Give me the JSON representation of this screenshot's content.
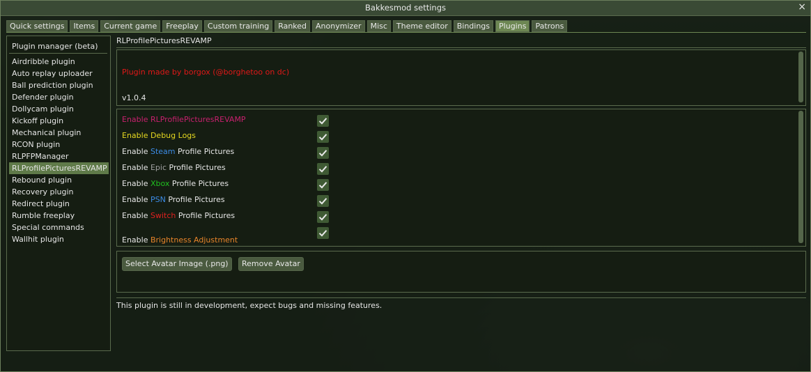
{
  "window": {
    "title": "Bakkesmod settings",
    "close_glyph": "×"
  },
  "tabs": [
    {
      "label": "Quick settings"
    },
    {
      "label": "Items"
    },
    {
      "label": "Current game"
    },
    {
      "label": "Freeplay"
    },
    {
      "label": "Custom training"
    },
    {
      "label": "Ranked"
    },
    {
      "label": "Anonymizer"
    },
    {
      "label": "Misc"
    },
    {
      "label": "Theme editor"
    },
    {
      "label": "Bindings"
    },
    {
      "label": "Plugins",
      "active": true
    },
    {
      "label": "Patrons"
    }
  ],
  "sidebar": {
    "header": "Plugin manager (beta)",
    "items": [
      {
        "label": "Airdribble plugin"
      },
      {
        "label": "Auto replay uploader"
      },
      {
        "label": "Ball prediction plugin"
      },
      {
        "label": "Defender plugin"
      },
      {
        "label": "Dollycam plugin"
      },
      {
        "label": "Kickoff plugin"
      },
      {
        "label": "Mechanical plugin"
      },
      {
        "label": "RCON plugin"
      },
      {
        "label": "RLPFPManager"
      },
      {
        "label": "RLProfilePicturesREVAMP",
        "selected": true
      },
      {
        "label": "Rebound plugin"
      },
      {
        "label": "Recovery plugin"
      },
      {
        "label": "Redirect plugin"
      },
      {
        "label": "Rumble freeplay"
      },
      {
        "label": "Special commands"
      },
      {
        "label": "Wallhit plugin"
      }
    ]
  },
  "plugin": {
    "title": "RLProfilePicturesREVAMP",
    "made_by": "Plugin made by borgox (@borghetoo on dc)",
    "version": "v1.0.4",
    "options": [
      {
        "parts": [
          {
            "text": "Enable RLProfilePicturesREVAMP",
            "color": "#c8206e"
          }
        ],
        "checked": true
      },
      {
        "parts": [
          {
            "text": "Enable Debug Logs",
            "color": "#e6d820"
          }
        ],
        "checked": true
      },
      {
        "parts": [
          {
            "text": "Enable ",
            "color": "#e6e6e6"
          },
          {
            "text": "Steam",
            "color": "#3c8ce6"
          },
          {
            "text": " Profile Pictures",
            "color": "#e6e6e6"
          }
        ],
        "checked": true
      },
      {
        "parts": [
          {
            "text": "Enable ",
            "color": "#e6e6e6"
          },
          {
            "text": "Epic",
            "color": "#a0a0a0"
          },
          {
            "text": " Profile Pictures",
            "color": "#e6e6e6"
          }
        ],
        "checked": true
      },
      {
        "parts": [
          {
            "text": "Enable ",
            "color": "#e6e6e6"
          },
          {
            "text": "Xbox",
            "color": "#20c020"
          },
          {
            "text": " Profile Pictures",
            "color": "#e6e6e6"
          }
        ],
        "checked": true
      },
      {
        "parts": [
          {
            "text": "Enable ",
            "color": "#e6e6e6"
          },
          {
            "text": "PSN",
            "color": "#3c8ce6"
          },
          {
            "text": " Profile Pictures",
            "color": "#e6e6e6"
          }
        ],
        "checked": true
      },
      {
        "parts": [
          {
            "text": "Enable ",
            "color": "#e6e6e6"
          },
          {
            "text": "Switch",
            "color": "#e02020"
          },
          {
            "text": " Profile Pictures",
            "color": "#e6e6e6"
          }
        ],
        "checked": true
      },
      {
        "parts": [
          {
            "text": "Enable ",
            "color": "#e6e6e6"
          },
          {
            "text": "Brightness Adjustment",
            "color": "#e8842a"
          }
        ],
        "checked": true
      }
    ],
    "buttons": {
      "select_avatar": "Select Avatar Image (.png)",
      "remove_avatar": "Remove Avatar"
    },
    "note": "This plugin is still in development, expect bugs and missing features."
  },
  "colors": {
    "accent": "#6d8753",
    "check_bg": "#3f5a34",
    "border": "#5a6b4d"
  },
  "icons": {
    "checkbox": "check-icon",
    "close": "close-icon"
  }
}
